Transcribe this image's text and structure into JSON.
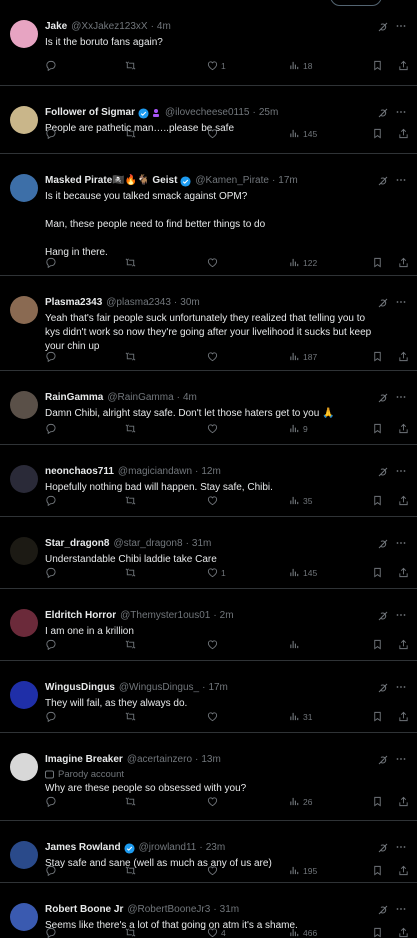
{
  "tweets": [
    {
      "name": "Jake",
      "handle": "@XxJakez123xX",
      "time": "4m",
      "text": "Is it the boruto fans again?",
      "likes": "1",
      "views": "18",
      "verified": false,
      "avatar_color": "#e7a4c2"
    },
    {
      "name": "Follower of Sigmar",
      "handle": "@ilovecheese0115",
      "time": "25m",
      "text": "People are pathetic man…..please be safe",
      "views": "145",
      "verified": true,
      "badge": "person-icon",
      "avatar_color": "#c9b68a"
    },
    {
      "name": "Masked Pirate🏴‍☠️🔥🐐 Geist",
      "handle": "@Kamen_Pirate",
      "time": "17m",
      "text": "Is it because you talked smack against OPM?\n\nMan, these people need to find better things to do\n\nHang in there.",
      "views": "122",
      "verified": true,
      "avatar_color": "#3d6fa8"
    },
    {
      "name": "Plasma2343",
      "handle": "@plasma2343",
      "time": "30m",
      "text": "Yeah that's fair people suck unfortunately they realized that telling you to kys didn't work so now they're going after your livelihood it sucks but keep your chin up",
      "views": "187",
      "verified": false,
      "avatar_color": "#8a6a52"
    },
    {
      "name": "RainGamma",
      "handle": "@RainGamma",
      "time": "4m",
      "text": "Damn Chibi, alright stay safe. Don't let those haters get to you 🙏",
      "views": "9",
      "verified": false,
      "avatar_color": "#5a5048"
    },
    {
      "name": "neonchaos711",
      "handle": "@magiciandawn",
      "time": "12m",
      "text": "Hopefully nothing bad will happen. Stay safe, Chibi.",
      "views": "35",
      "verified": false,
      "avatar_color": "#2a2a38"
    },
    {
      "name": "Star_dragon8",
      "handle": "@star_dragon8",
      "time": "31m",
      "text": "Understandable Chibi laddie take Care",
      "likes": "1",
      "views": "145",
      "verified": false,
      "avatar_color": "#1c1a14"
    },
    {
      "name": "Eldritch Horror",
      "handle": "@Themyster1ous01",
      "time": "2m",
      "text": "I am one in a krillion",
      "verified": false,
      "avatar_color": "#6b2a3a"
    },
    {
      "name": "WingusDingus",
      "handle": "@WingusDingus_",
      "time": "17m",
      "text": "They will fail, as they always do.",
      "views": "31",
      "verified": false,
      "avatar_color": "#1f2fa8"
    },
    {
      "name": "Imagine Breaker",
      "handle": "@acertainzero",
      "time": "13m",
      "parody": "Parody account",
      "text": "Why are these people so obsessed with you?",
      "views": "26",
      "verified": false,
      "avatar_color": "#d8d8d8"
    },
    {
      "name": "James Rowland",
      "handle": "@jrowland11",
      "time": "23m",
      "text": "Stay safe and sane (well as much as any of us are)",
      "views": "195",
      "verified": true,
      "avatar_color": "#2a4a8a"
    },
    {
      "name": "Robert Boone Jr",
      "handle": "@RobertBooneJr3",
      "time": "31m",
      "text": "Seems like there's a lot of that going on atm it's a shame.",
      "likes": "4",
      "views": "466",
      "verified": false,
      "avatar_color": "#3a5ab0"
    }
  ],
  "colors": {
    "verified": "#1d9bf0",
    "muted": "#71767b",
    "divider": "#2f3336",
    "background": "#000000"
  }
}
